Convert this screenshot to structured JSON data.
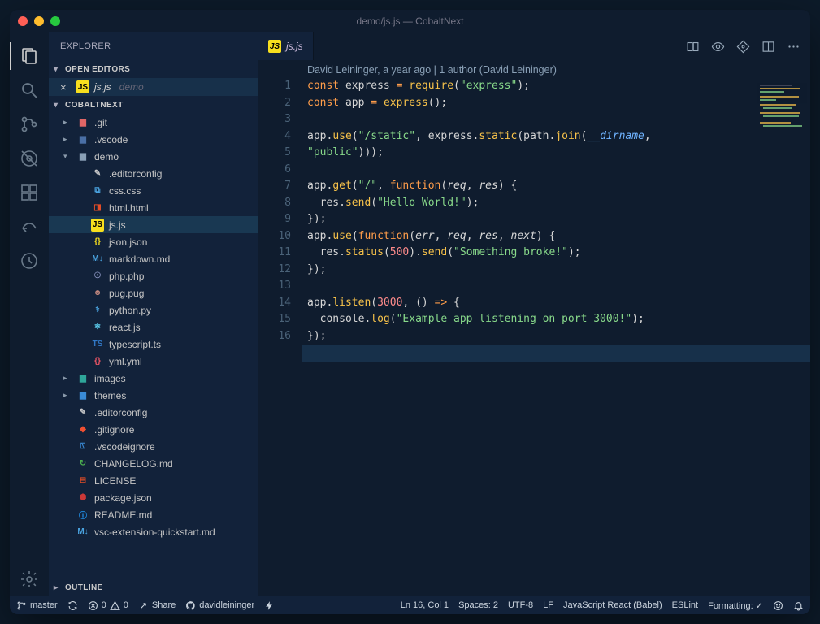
{
  "window": {
    "title": "demo/js.js — CobaltNext"
  },
  "sidebar": {
    "title": "EXPLORER",
    "sections": {
      "open_editors": {
        "label": "OPEN EDITORS"
      },
      "project": {
        "label": "COBALTNEXT"
      },
      "outline": {
        "label": "OUTLINE"
      }
    }
  },
  "open_editor": {
    "file": "js.js",
    "folder": "demo"
  },
  "tree": [
    {
      "depth": 1,
      "icon": "folder",
      "name": ".git",
      "expandable": true,
      "open": false,
      "color": "#e06666"
    },
    {
      "depth": 1,
      "icon": "folder",
      "name": ".vscode",
      "expandable": true,
      "open": false,
      "color": "#4a6fa5"
    },
    {
      "depth": 1,
      "icon": "folder",
      "name": "demo",
      "expandable": true,
      "open": true,
      "color": "#8aa0b6"
    },
    {
      "depth": 2,
      "icon": "editorconfig",
      "name": ".editorconfig"
    },
    {
      "depth": 2,
      "icon": "css",
      "name": "css.css"
    },
    {
      "depth": 2,
      "icon": "html",
      "name": "html.html"
    },
    {
      "depth": 2,
      "icon": "js",
      "name": "js.js",
      "active": true
    },
    {
      "depth": 2,
      "icon": "json",
      "name": "json.json"
    },
    {
      "depth": 2,
      "icon": "md",
      "name": "markdown.md"
    },
    {
      "depth": 2,
      "icon": "php",
      "name": "php.php"
    },
    {
      "depth": 2,
      "icon": "pug",
      "name": "pug.pug"
    },
    {
      "depth": 2,
      "icon": "py",
      "name": "python.py"
    },
    {
      "depth": 2,
      "icon": "react",
      "name": "react.js"
    },
    {
      "depth": 2,
      "icon": "ts",
      "name": "typescript.ts"
    },
    {
      "depth": 2,
      "icon": "yml",
      "name": "yml.yml"
    },
    {
      "depth": 1,
      "icon": "folder",
      "name": "images",
      "expandable": true,
      "open": false,
      "color": "#2fa69a"
    },
    {
      "depth": 1,
      "icon": "folder",
      "name": "themes",
      "expandable": true,
      "open": false,
      "color": "#3a8bd6"
    },
    {
      "depth": 1,
      "icon": "editorconfig",
      "name": ".editorconfig"
    },
    {
      "depth": 1,
      "icon": "git",
      "name": ".gitignore"
    },
    {
      "depth": 1,
      "icon": "vscode",
      "name": ".vscodeignore",
      "color": "#3a8bd6"
    },
    {
      "depth": 1,
      "icon": "changelog",
      "name": "CHANGELOG.md"
    },
    {
      "depth": 1,
      "icon": "license",
      "name": "LICENSE"
    },
    {
      "depth": 1,
      "icon": "npm",
      "name": "package.json"
    },
    {
      "depth": 1,
      "icon": "readme",
      "name": "README.md"
    },
    {
      "depth": 1,
      "icon": "md",
      "name": "vsc-extension-quickstart.md"
    }
  ],
  "tab": {
    "file": "js.js"
  },
  "blame": "David Leininger, a year ago | 1 author (David Leininger)",
  "code_lines": 16,
  "statusbar": {
    "branch": "master",
    "errors": "0",
    "warnings": "0",
    "share": "Share",
    "user": "davidleininger",
    "position": "Ln 16, Col 1",
    "spaces": "Spaces: 2",
    "encoding": "UTF-8",
    "eol": "LF",
    "language": "JavaScript React (Babel)",
    "linter": "ESLint",
    "formatting": "Formatting: ✓"
  },
  "colors": {
    "background": "#0f1c2e",
    "sidebar": "#12223a",
    "accent_orange": "#ff9d4a",
    "accent_green": "#88d98a",
    "accent_yellow": "#f7c24a"
  }
}
